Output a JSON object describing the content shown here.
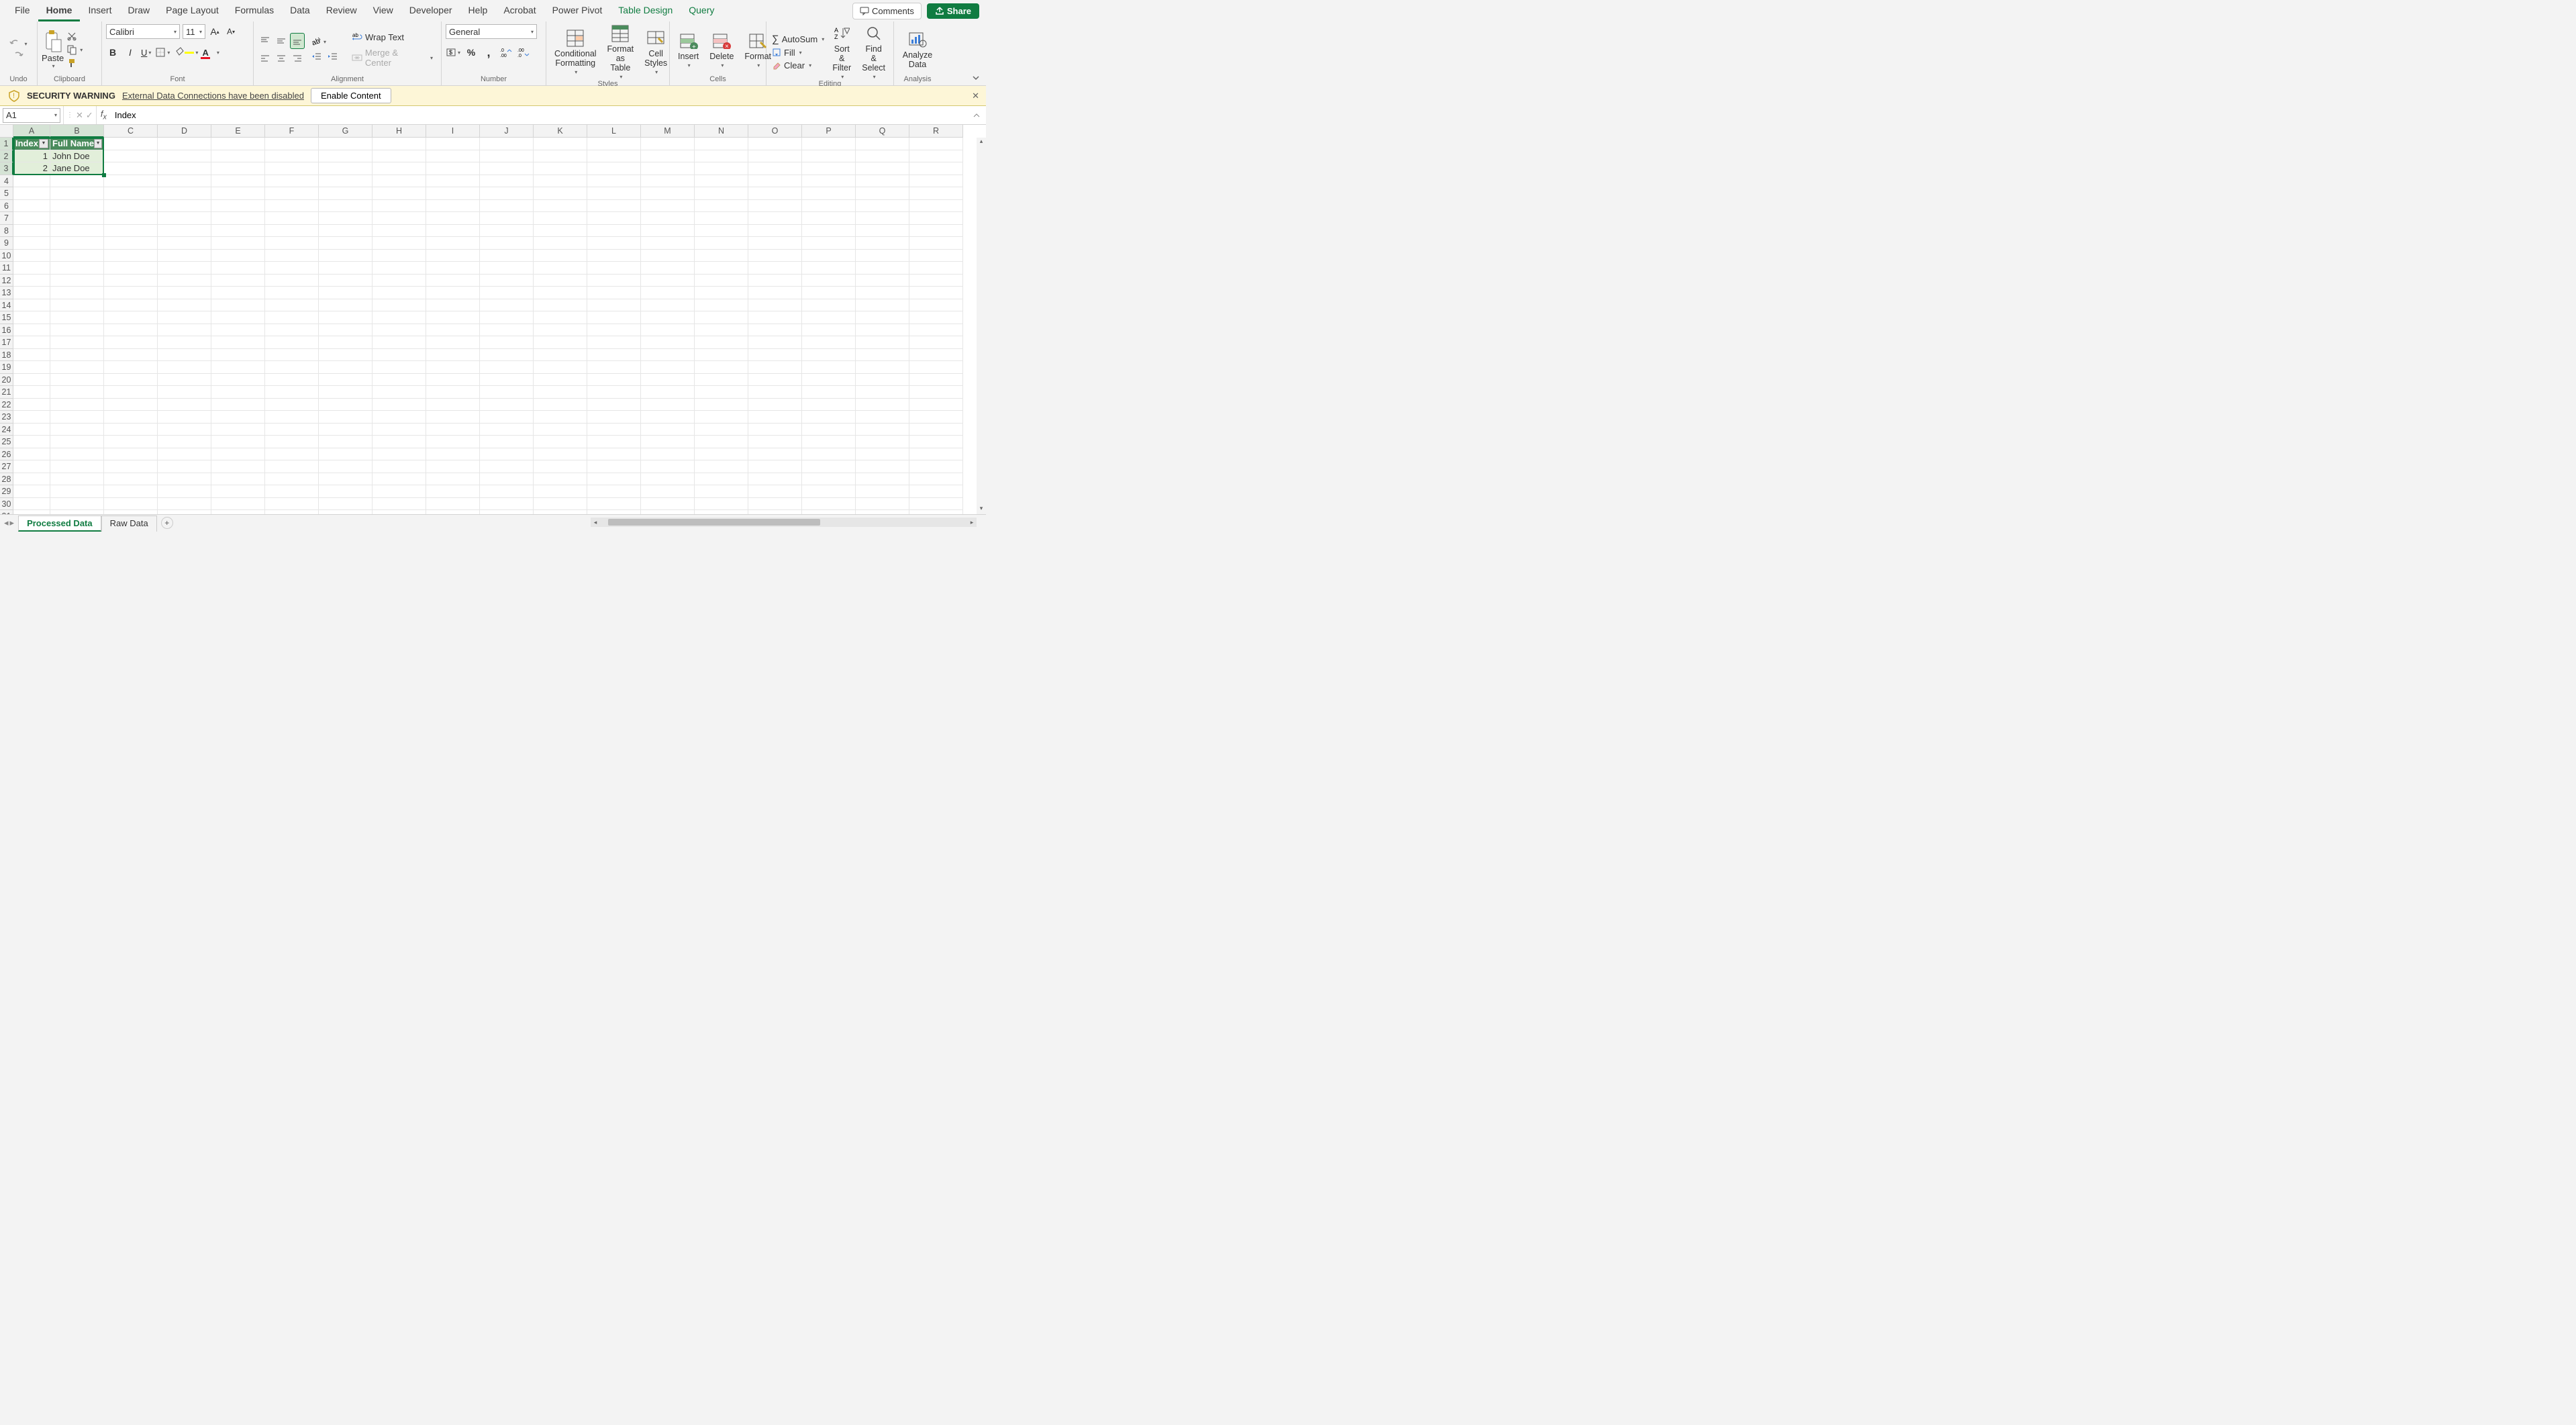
{
  "tabs": [
    "File",
    "Home",
    "Insert",
    "Draw",
    "Page Layout",
    "Formulas",
    "Data",
    "Review",
    "View",
    "Developer",
    "Help",
    "Acrobat",
    "Power Pivot",
    "Table Design",
    "Query"
  ],
  "active_tab": "Home",
  "green_tabs": [
    "Table Design",
    "Query"
  ],
  "comments_label": "Comments",
  "share_label": "Share",
  "groups": {
    "undo": "Undo",
    "clipboard": "Clipboard",
    "font": "Font",
    "alignment": "Alignment",
    "number": "Number",
    "styles": "Styles",
    "cells": "Cells",
    "editing": "Editing",
    "analysis": "Analysis"
  },
  "paste_label": "Paste",
  "font_name": "Calibri",
  "font_size": "11",
  "wrap_label": "Wrap Text",
  "merge_label": "Merge & Center",
  "number_format": "General",
  "cond_fmt": "Conditional Formatting",
  "fmt_table": "Format as Table",
  "cell_styles": "Cell Styles",
  "insert_label": "Insert",
  "delete_label": "Delete",
  "format_label": "Format",
  "autosum": "AutoSum",
  "fill": "Fill",
  "clear": "Clear",
  "sort_filter": "Sort & Filter",
  "find_select": "Find & Select",
  "analyze": "Analyze Data",
  "msgbar": {
    "title": "SECURITY WARNING",
    "text": "External Data Connections have been disabled",
    "button": "Enable Content"
  },
  "name_box": "A1",
  "formula": "Index",
  "columns": [
    "A",
    "B",
    "C",
    "D",
    "E",
    "F",
    "G",
    "H",
    "I",
    "J",
    "K",
    "L",
    "M",
    "N",
    "O",
    "P",
    "Q",
    "R"
  ],
  "col_widths": {
    "A": 55,
    "B": 80,
    "default": 80
  },
  "sel_cols": [
    "A",
    "B"
  ],
  "sel_rows": [
    1,
    2,
    3
  ],
  "rows": 31,
  "table": {
    "headers": [
      "Index",
      "Full Name"
    ],
    "data": [
      {
        "index": "1",
        "name": "John Doe"
      },
      {
        "index": "2",
        "name": "Jane Doe"
      }
    ]
  },
  "sheets": [
    "Processed Data",
    "Raw Data"
  ],
  "active_sheet": "Processed Data"
}
